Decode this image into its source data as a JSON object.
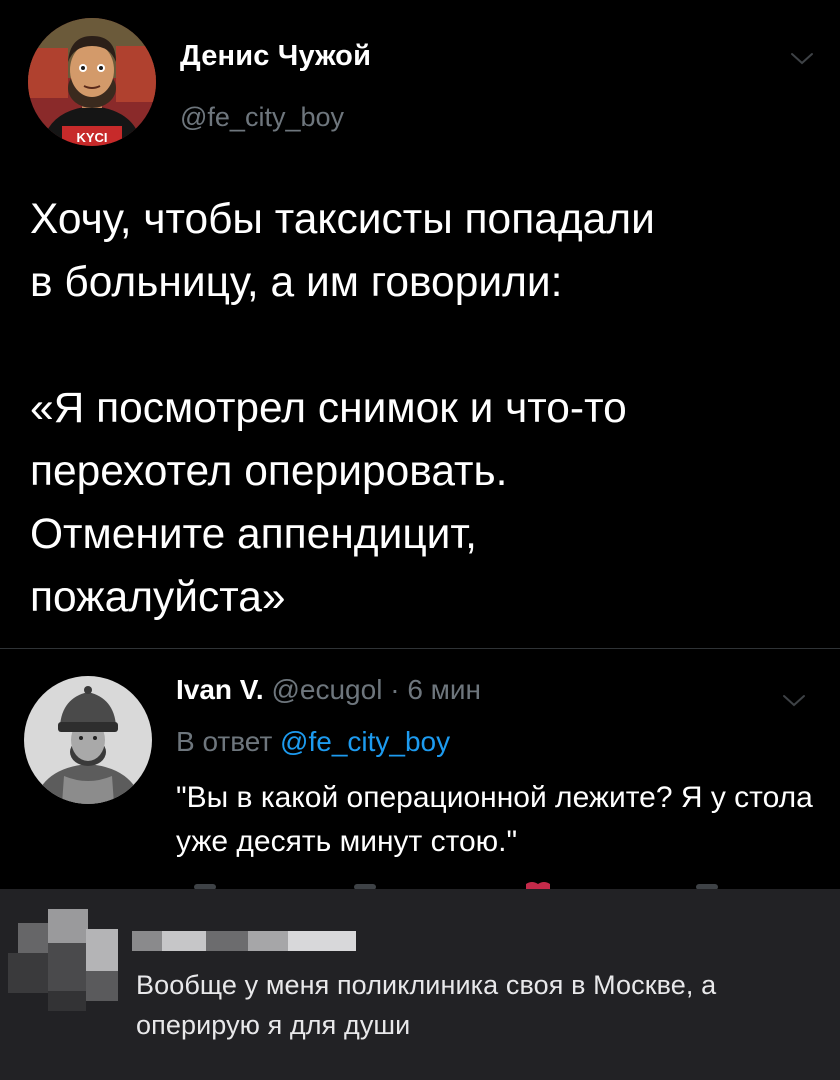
{
  "main_tweet": {
    "author_name": "Денис Чужой",
    "author_handle": "@fe_city_boy",
    "avatar_badge": "KYCI",
    "text_paragraph_1": "Хочу, чтобы таксисты попадали\nв больницу, а им говорили:",
    "text_paragraph_2": "«Я посмотрел снимок и что-то\nперехотел оперировать.\nОтмените аппендицит,\nпожалуйста»",
    "menu_icon": "chevron-down-icon"
  },
  "reply": {
    "author_name": "Ivan V.",
    "author_handle": "@ecugol",
    "separator": " · ",
    "time": "6 мин",
    "reply_to_prefix": "В ответ ",
    "reply_to_mention": "@fe_city_boy",
    "text": "\"Вы в какой операционной лежите? Я у стола уже десять минут стою.\"",
    "menu_icon": "chevron-down-icon"
  },
  "comment": {
    "text": "Вообще у меня поликлиника своя в Москве, а оперирую я для души"
  },
  "colors": {
    "background": "#000000",
    "primary_text": "#ffffff",
    "secondary_text": "#6e767d",
    "link": "#1d9bf0",
    "comment_background": "#222225",
    "divider": "#2f3336"
  }
}
